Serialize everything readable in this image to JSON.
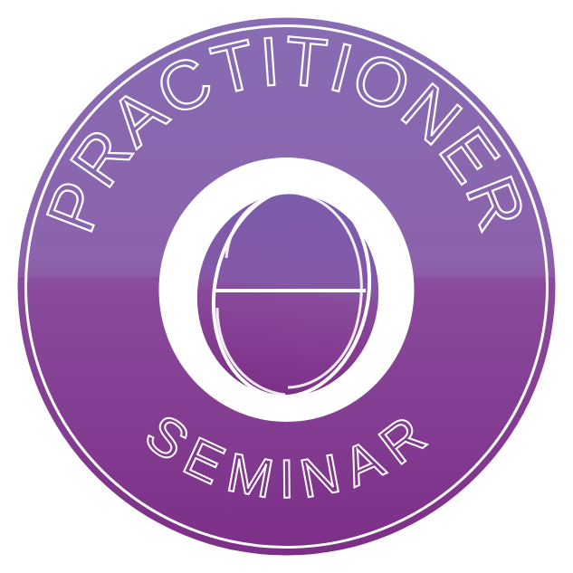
{
  "badge": {
    "top_text": "PRACTITIONER",
    "bottom_text": "SEMINAR",
    "symbol_icon": "theta-egg-icon",
    "colors": {
      "background": "#ffffff",
      "purple_light": "#7f5fae",
      "purple_mid": "#8a4e9e",
      "purple_dark": "#7a2f86",
      "rim": "#ffffff",
      "text": "#ffffff"
    }
  }
}
